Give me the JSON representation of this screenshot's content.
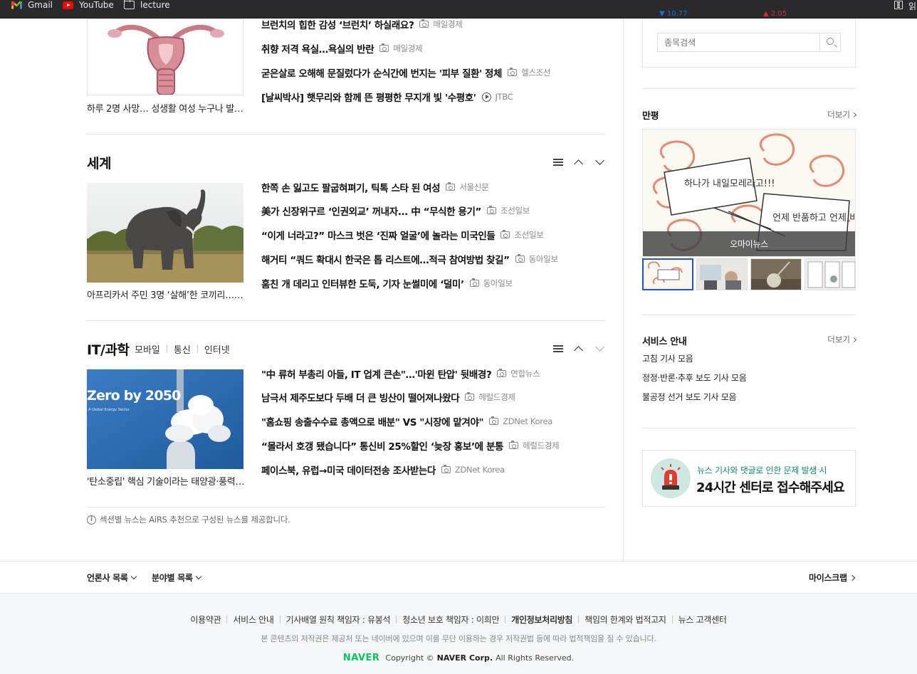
{
  "bookmarks": {
    "gmail": "Gmail",
    "youtube": "YouTube",
    "lecture": "lecture",
    "right_fragment": "읽"
  },
  "health": {
    "caption": "하루 2명 사망… 성생활 여성 누구나 발생...",
    "headlines": [
      {
        "title": "브런치의 힙한 감성 ‘브런치’ 하실래요?",
        "source": "매일경제",
        "media": "photo"
      },
      {
        "title": "취향 저격 욕실…욕실의 반란",
        "source": "매일경제",
        "media": "photo"
      },
      {
        "title": "굳은살로 오해해 문질렀다가 순식간에 번지는 '피부 질환' 정체",
        "source": "헬스조선",
        "media": "photo"
      },
      {
        "title": "[날씨박사] 햇무리와 함께 뜬 평평한 무지개 빛 '수평호'",
        "source": "JTBC",
        "media": "video"
      }
    ]
  },
  "world": {
    "title": "세계",
    "caption": "아프리카서 주민 3명 ‘살해’한 코끼리…사...",
    "headlines": [
      {
        "title": "한쪽 손 잃고도 팔굽혀펴기, 틱톡 스타 된 여성",
        "source": "서울신문"
      },
      {
        "title": "美가 신장위구르 ‘인권외교’ 꺼내자... 中 “무식한 용기”",
        "source": "조선일보"
      },
      {
        "title": "“이게 너라고?” 마스크 벗은 ‘진짜 얼굴’에 놀라는 미국인들",
        "source": "조선일보"
      },
      {
        "title": "해거티 “쿼드 확대시 한국은 톱 리스트에…적극 참여방법 찾길”",
        "source": "동아일보"
      },
      {
        "title": "훔친 개 데리고 인터뷰한 도둑, 기자 눈썰미에 ‘덜미’",
        "source": "동아일보"
      }
    ]
  },
  "it": {
    "title": "IT/과학",
    "subnav": [
      "모바일",
      "통신",
      "인터넷"
    ],
    "caption": "'탄소중립' 핵심 기술이라는 태양광·풍력, ...",
    "image_text": "Zero by 2050",
    "image_subtext": "A Global Energy Sector",
    "headlines": [
      {
        "title": "\"中 류허 부총리 아들, IT 업계 큰손\"…'마윈 탄압' 뒷배경?",
        "source": "연합뉴스"
      },
      {
        "title": "남극서 제주도보다 두배 더 큰 빙산이 떨어져나왔다",
        "source": "헤럴드경제"
      },
      {
        "title": "\"홈쇼핑 송출수수료 총액으로 배분\" VS \"시장에 맡겨야\"",
        "source": "ZDNet Korea"
      },
      {
        "title": "“몰라서 호갱 됐습니다” 통신비 25%할인 ‘늦장 홍보’에 분통",
        "source": "헤럴드경제"
      },
      {
        "title": "페이스북, 유럽→미국 데이터전송 조사받는다",
        "source": "ZDNet Korea"
      }
    ]
  },
  "airs_note": "섹션별 뉴스는 AiRS 추천으로 구성된 뉴스를 제공합니다.",
  "right": {
    "stock_up": "▼ 10.77",
    "stock_down": "▲ 2.05",
    "search_placeholder": "종목검색",
    "cartoon_title": "만평",
    "more": "더보기",
    "cartoon_source": "오마이뉴스",
    "cartoon_speech1": "하나가 내일모레라고!!!",
    "cartoon_speech2": "언제 반품하고 언제 비나나?",
    "service_title": "서비스 안내",
    "service_links": [
      "고침 기사 모음",
      "정정·반론·추후 보도 기사 모음",
      "불공정 선거 보도 기사 모음"
    ],
    "banner_line1": "뉴스 기사와 댓글로 인한 문제 발생 시",
    "banner_line2": "24시간 센터로 접수해주세요"
  },
  "footer": {
    "press_list": "언론사 목록",
    "category_list": "분야별 목록",
    "myscrap": "마이스크랩",
    "links": [
      "이용약관",
      "서비스 안내",
      "기사배열 원칙 책임자 : 유봉석",
      "청소년 보호 책임자 : 이희만",
      "개인정보처리방침",
      "책임의 한계와 법적고지",
      "뉴스 고객센터"
    ],
    "notice": "본 콘텐츠의 저작권은 제공처 또는 네이버에 있으며 이를 무단 이용하는 경우 저작권법 등에 따라 법적책임을 질 수 있습니다.",
    "logo": "NAVER",
    "copyright_prefix": "Copyright ©",
    "corp": "NAVER Corp.",
    "rights": "All Rights Reserved."
  }
}
